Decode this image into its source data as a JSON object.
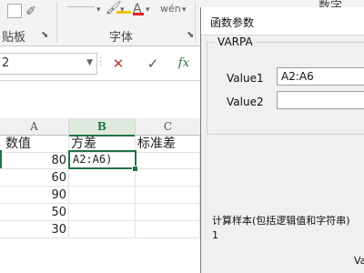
{
  "ribbon": {
    "clipboard_label": "贴板",
    "font_group_label": "字体",
    "number_tab_label": "数字",
    "wen_glyph": "wén"
  },
  "formula_bar": {
    "name_box": "2",
    "fx_label": "fx"
  },
  "sheet": {
    "columns": [
      "A",
      "B",
      "C"
    ],
    "header_row": [
      "数值",
      "方差",
      "标准差"
    ],
    "values": [
      "80",
      "60",
      "90",
      "50",
      "30"
    ],
    "editing_cell": "A2:A6)"
  },
  "dialog": {
    "title": "函数参数",
    "function_name": "VARPA",
    "param1_label": "Value1",
    "param1_value": "A2:A6",
    "param2_label": "Value2",
    "param2_value": "",
    "description": "计算样本(包括逻辑值和字符串)",
    "description_line2": "1",
    "bottom_text": "Va"
  },
  "colors": {
    "excel_green": "#217346",
    "cancel_red": "#c0392b",
    "enter_gray": "#555555"
  }
}
